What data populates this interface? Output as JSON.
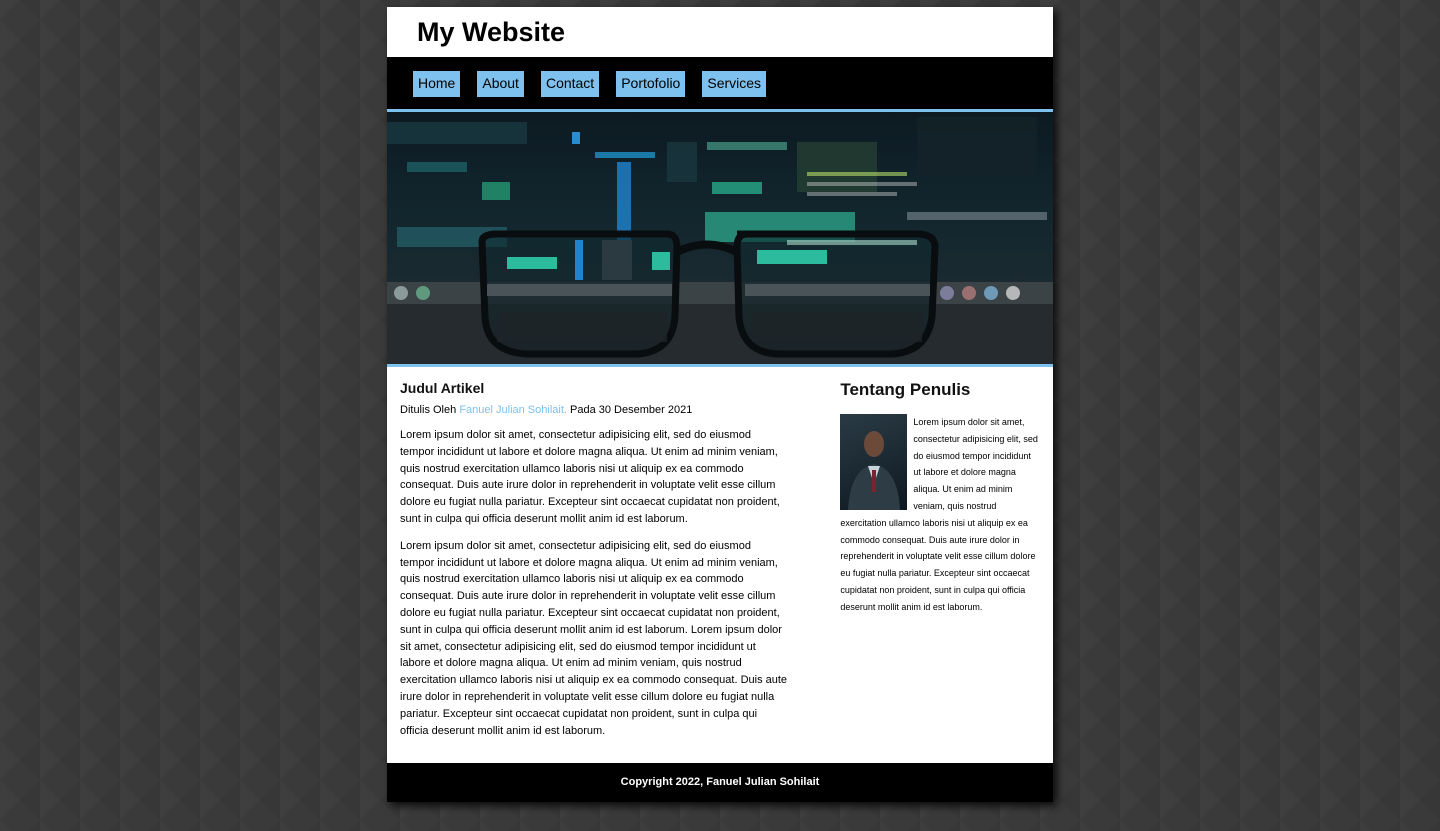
{
  "site": {
    "title": "My Website"
  },
  "nav": {
    "items": [
      {
        "label": "Home"
      },
      {
        "label": "About"
      },
      {
        "label": "Contact"
      },
      {
        "label": "Portofolio"
      },
      {
        "label": "Services"
      }
    ]
  },
  "hero": {
    "description_icon": "glasses-over-code-image"
  },
  "article": {
    "title": "Judul Artikel",
    "byline_prefix": "Ditulis Oleh",
    "author": "Fanuel Julian Sohilait.",
    "date_text": "Pada 30 Desember 2021",
    "paragraphs": [
      "Lorem ipsum dolor sit amet, consectetur adipisicing elit, sed do eiusmod tempor incididunt ut labore et dolore magna aliqua. Ut enim ad minim veniam, quis nostrud exercitation ullamco laboris nisi ut aliquip ex ea commodo consequat. Duis aute irure dolor in reprehenderit in voluptate velit esse cillum dolore eu fugiat nulla pariatur. Excepteur sint occaecat cupidatat non proident, sunt in culpa qui officia deserunt mollit anim id est laborum.",
      "Lorem ipsum dolor sit amet, consectetur adipisicing elit, sed do eiusmod tempor incididunt ut labore et dolore magna aliqua. Ut enim ad minim veniam, quis nostrud exercitation ullamco laboris nisi ut aliquip ex ea commodo consequat. Duis aute irure dolor in reprehenderit in voluptate velit esse cillum dolore eu fugiat nulla pariatur. Excepteur sint occaecat cupidatat non proident, sunt in culpa qui officia deserunt mollit anim id est laborum. Lorem ipsum dolor sit amet, consectetur adipisicing elit, sed do eiusmod tempor incididunt ut labore et dolore magna aliqua. Ut enim ad minim veniam, quis nostrud exercitation ullamco laboris nisi ut aliquip ex ea commodo consequat. Duis aute irure dolor in reprehenderit in voluptate velit esse cillum dolore eu fugiat nulla pariatur. Excepteur sint occaecat cupidatat non proident, sunt in culpa qui officia deserunt mollit anim id est laborum."
    ]
  },
  "sidebar": {
    "title": "Tentang Penulis",
    "bio": "Lorem ipsum dolor sit amet, consectetur adipisicing elit, sed do eiusmod tempor incididunt ut labore et dolore magna aliqua. Ut enim ad minim veniam, quis nostrud exercitation ullamco laboris nisi ut aliquip ex ea commodo consequat. Duis aute irure dolor in reprehenderit in voluptate velit esse cillum dolore eu fugiat nulla pariatur. Excepteur sint occaecat cupidatat non proident, sunt in culpa qui officia deserunt mollit anim id est laborum."
  },
  "footer": {
    "copyright": "Copyright 2022, Fanuel Julian Sohilait"
  },
  "colors": {
    "accent": "#7ec0ee",
    "nav_bg": "#000000",
    "page_bg": "#3a3a3a"
  }
}
